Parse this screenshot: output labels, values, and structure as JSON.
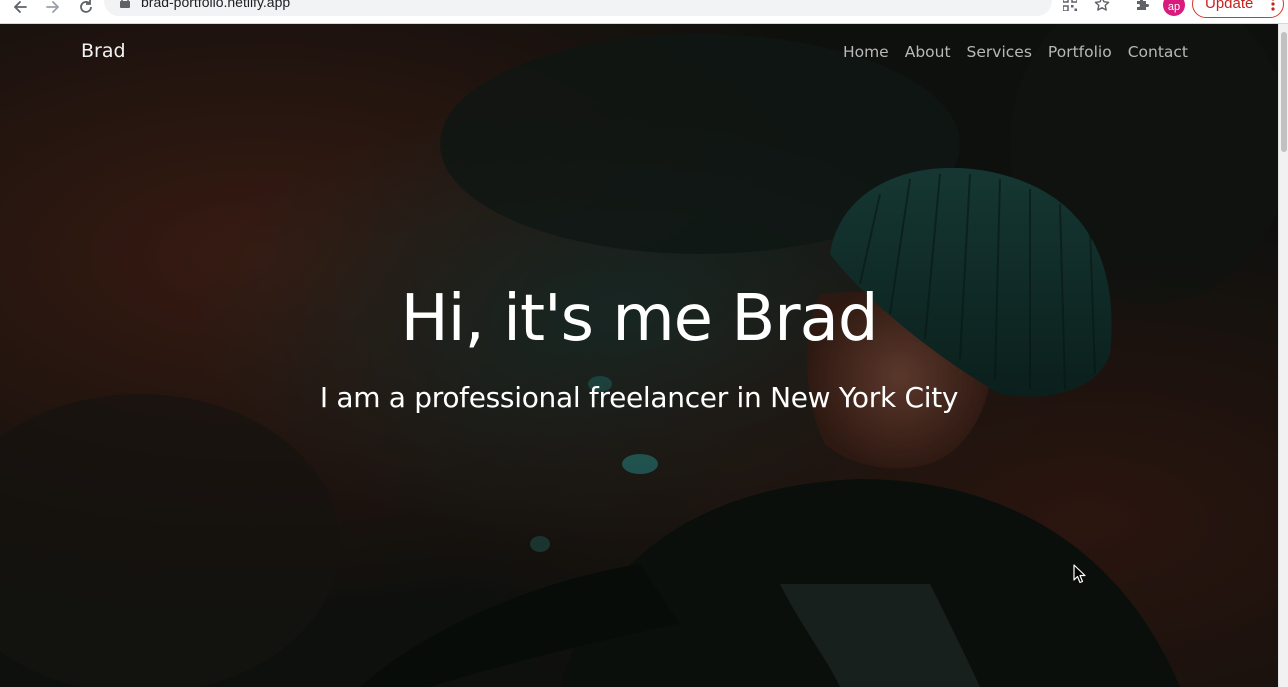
{
  "browser": {
    "url": "brad-portfolio.netlify.app",
    "avatar_initials": "ap",
    "update_label": "Update",
    "icons": [
      "back-icon",
      "forward-icon",
      "reload-icon",
      "lock-icon",
      "qr-code-icon",
      "star-icon",
      "extensions-icon",
      "more-icon"
    ]
  },
  "navbar": {
    "brand": "Brad",
    "links": [
      "Home",
      "About",
      "Services",
      "Portfolio",
      "Contact"
    ]
  },
  "hero": {
    "title": "Hi, it's me Brad",
    "subtitle": "I am a professional freelancer in New York City"
  },
  "colors": {
    "nav_link": "#b8b8b8",
    "brand": "#f2f2f2",
    "hero_text": "#ffffff",
    "update_accent": "#c5221f",
    "avatar": "#d81b7c"
  }
}
